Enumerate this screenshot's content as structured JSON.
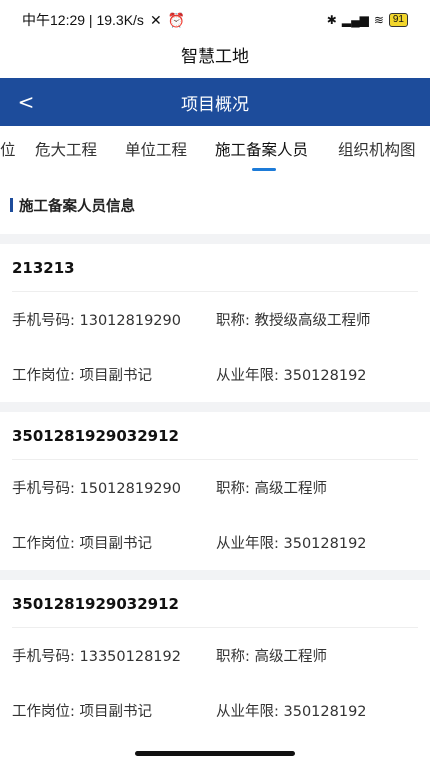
{
  "status": {
    "time_net": "中午12:29 | 19.3K/s",
    "icons_left": [
      "mute-icon",
      "alarm-icon"
    ],
    "icons_right": [
      "bluetooth-icon",
      "signal-icon",
      "wifi-icon"
    ],
    "battery": "91"
  },
  "app_title": "智慧工地",
  "nav": {
    "back_label": "<",
    "title": "项目概况"
  },
  "tabs": [
    "位",
    "危大工程",
    "单位工程",
    "施工备案人员",
    "组织机构图"
  ],
  "active_tab": "施工备案人员",
  "section_title": "施工备案人员信息",
  "labels": {
    "phone": "手机号码:",
    "title": "职称:",
    "post": "工作岗位:",
    "years": "从业年限:"
  },
  "people": [
    {
      "name": "213213",
      "phone": "13012819290",
      "title": "教授级高级工程师",
      "post": "项目副书记",
      "years": "350128192"
    },
    {
      "name": "3501281929032912",
      "phone": "15012819290",
      "title": "高级工程师",
      "post": "项目副书记",
      "years": "350128192"
    },
    {
      "name": "3501281929032912",
      "phone": "13350128192",
      "title": "高级工程师",
      "post": "项目副书记",
      "years": "350128192"
    }
  ]
}
